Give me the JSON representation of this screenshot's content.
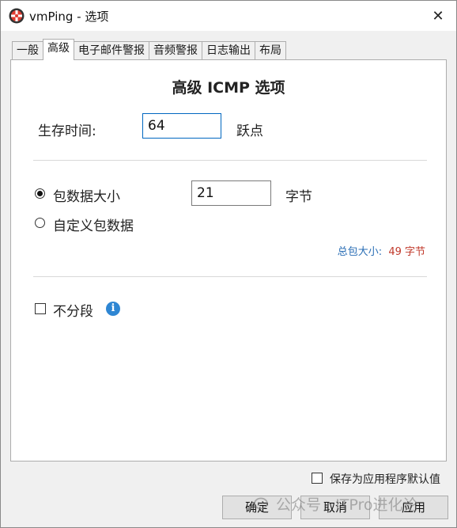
{
  "window": {
    "title": "vmPing - 选项"
  },
  "tabs": [
    {
      "label": "一般"
    },
    {
      "label": "高级"
    },
    {
      "label": "电子邮件警报"
    },
    {
      "label": "音频警报"
    },
    {
      "label": "日志输出"
    },
    {
      "label": "布局"
    }
  ],
  "panel": {
    "title": "高级 ICMP 选项",
    "ttl_label": "生存时间:",
    "ttl_value": "64",
    "ttl_unit": "跃点",
    "packet_size_label": "包数据大小",
    "packet_size_value": "21",
    "packet_size_unit": "字节",
    "custom_data_label": "自定义包数据",
    "total_size_label": "总包大小:",
    "total_size_value": "49 字节",
    "dont_fragment_label": "不分段"
  },
  "footer": {
    "save_default_label": "保存为应用程序默认值",
    "ok_label": "确定",
    "cancel_label": "取消",
    "apply_label": "应用"
  },
  "watermark": {
    "text": "公众号 · ITPro进化论"
  },
  "colors": {
    "accent": "#0067c0",
    "info_blue": "#2e86d3",
    "total_label": "#2a6eb5",
    "total_value": "#c0392b"
  }
}
